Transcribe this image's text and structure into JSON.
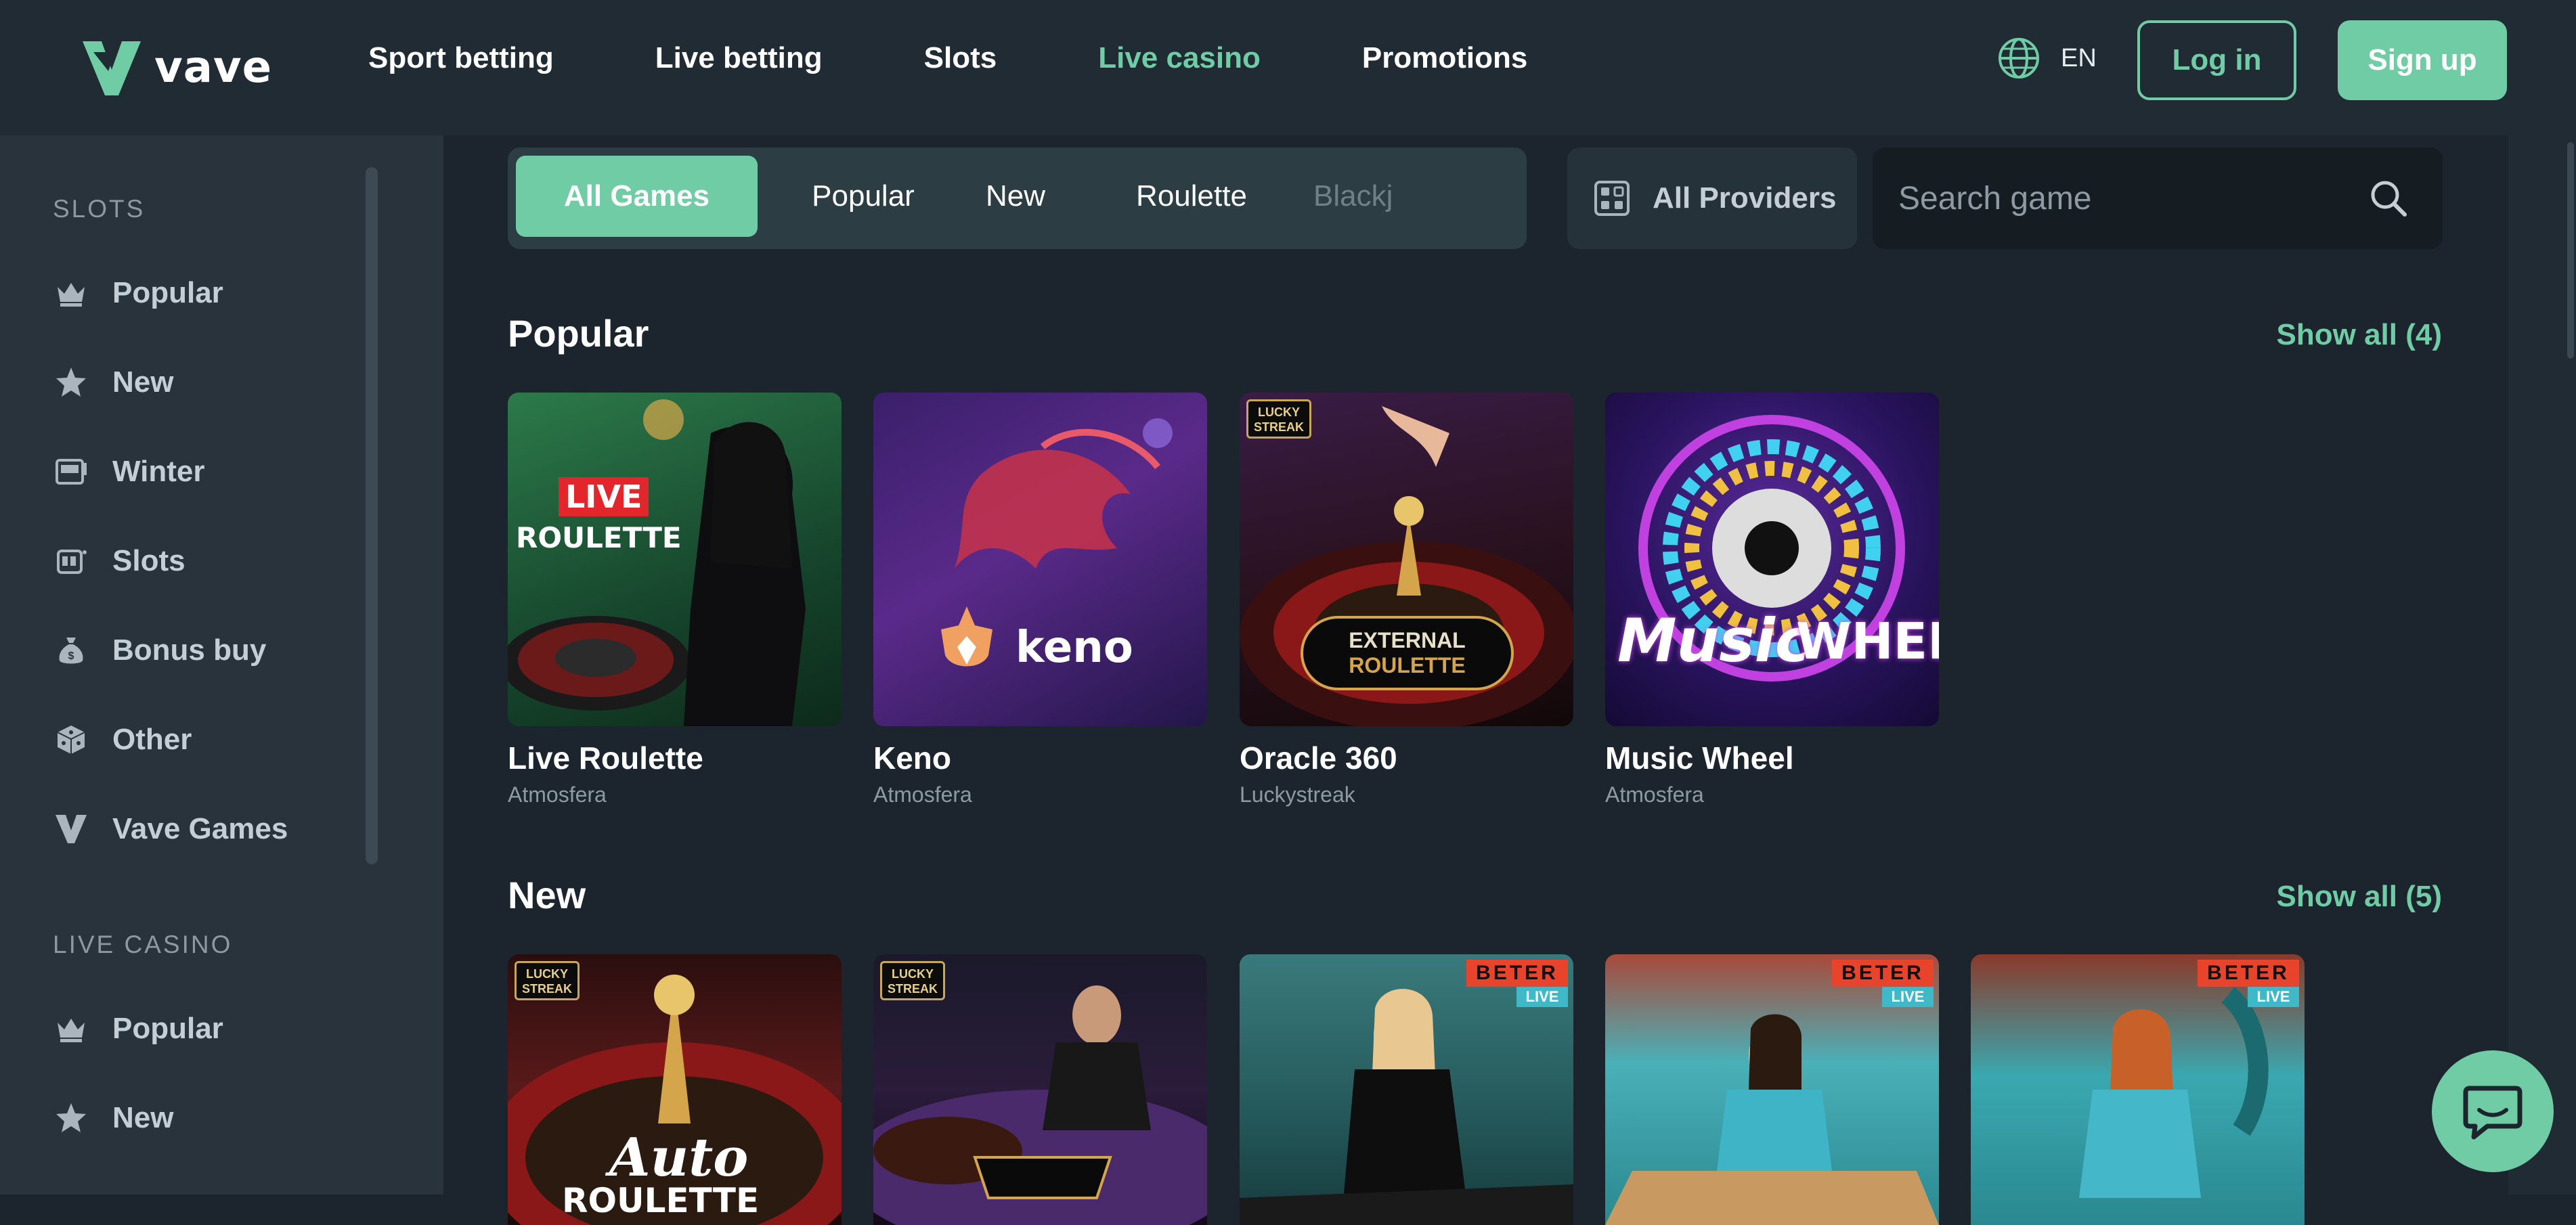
{
  "header": {
    "logo_text": "vave",
    "nav": [
      "Sport betting",
      "Live betting",
      "Slots",
      "Live casino",
      "Promotions"
    ],
    "active_nav": "Live casino",
    "language": "EN",
    "login_label": "Log in",
    "signup_label": "Sign up"
  },
  "sidebar": {
    "slots_section": "SLOTS",
    "slots_items": [
      {
        "label": "Popular",
        "icon": "crown-icon"
      },
      {
        "label": "New",
        "icon": "star-icon"
      },
      {
        "label": "Winter",
        "icon": "slot-machine-icon"
      },
      {
        "label": "Slots",
        "icon": "slot-reels-icon"
      },
      {
        "label": "Bonus buy",
        "icon": "money-bag-icon"
      },
      {
        "label": "Other",
        "icon": "dice-icon"
      },
      {
        "label": "Vave Games",
        "icon": "vave-logo-icon"
      }
    ],
    "live_section": "LIVE CASINO",
    "live_items": [
      {
        "label": "Popular",
        "icon": "crown-icon"
      },
      {
        "label": "New",
        "icon": "star-icon"
      }
    ]
  },
  "filters": {
    "tabs": [
      "All Games",
      "Popular",
      "New",
      "Roulette",
      "Blackj"
    ],
    "active_tab": "All Games",
    "providers_label": "All Providers",
    "search_placeholder": "Search game"
  },
  "sections": {
    "popular": {
      "title": "Popular",
      "show_all": "Show all (4)",
      "games": [
        {
          "name": "Live Roulette",
          "provider": "Atmosfera"
        },
        {
          "name": "Keno",
          "provider": "Atmosfera"
        },
        {
          "name": "Oracle 360",
          "provider": "Luckystreak"
        },
        {
          "name": "Music Wheel",
          "provider": "Atmosfera"
        }
      ]
    },
    "new": {
      "title": "New",
      "show_all": "Show all (5)"
    }
  },
  "thumb_text": {
    "live": "LIVE",
    "roulette": "ROULETTE",
    "keno": "keno",
    "lucky": "LUCKY",
    "streak": "STREAK",
    "external": "EXTERNAL",
    "roulette2": "ROULETTE",
    "music": "Music",
    "wheel": "WHEEL",
    "auto": "Auto",
    "roulette3": "ROULETTE",
    "beter": "BETER",
    "beter_live": "LIVE"
  },
  "colors": {
    "accent": "#6fcca4",
    "header_bg": "#202b34",
    "sidebar_bg": "#28333c",
    "main_bg": "#1c252d"
  }
}
